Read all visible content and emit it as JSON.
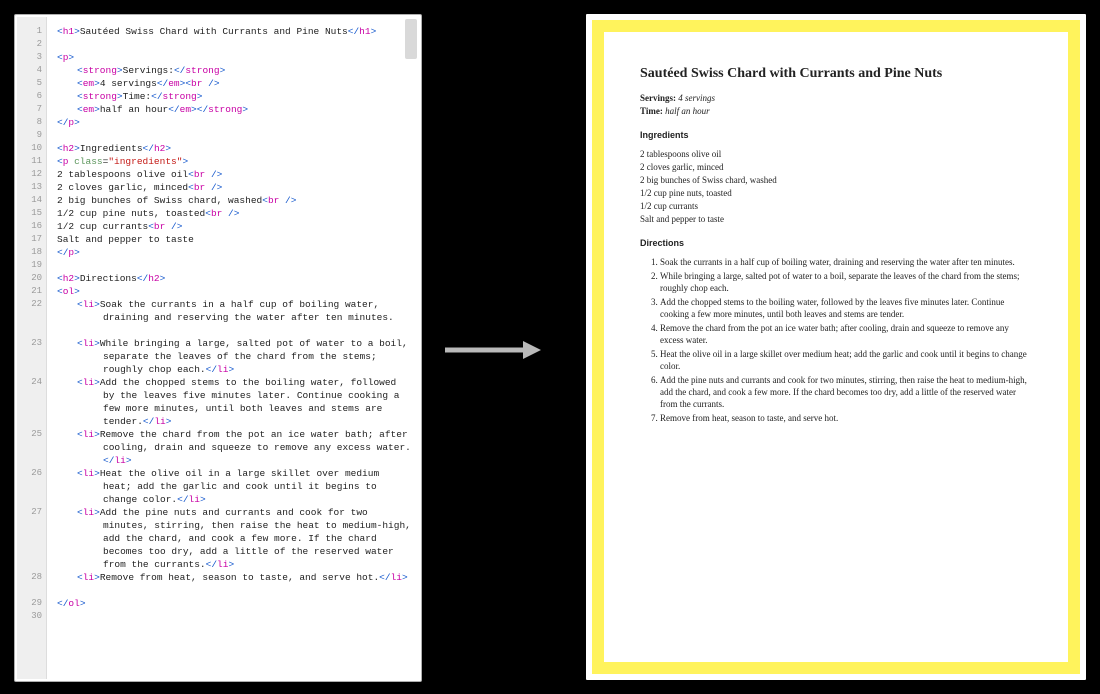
{
  "editor": {
    "total_lines": 30,
    "lines": [
      {
        "n": 1,
        "h": 1,
        "html": "<span class='tag'>&lt;</span><span class='kw'>h1</span><span class='tag'>&gt;</span>Sautéed Swiss Chard with Currants and Pine Nuts<span class='tag'>&lt;/</span><span class='kw'>h1</span><span class='tag'>&gt;</span>"
      },
      {
        "n": 2,
        "h": 1,
        "html": ""
      },
      {
        "n": 3,
        "h": 1,
        "html": "<span class='tag'>&lt;</span><span class='kw'>p</span><span class='tag'>&gt;</span>"
      },
      {
        "n": 4,
        "h": 1,
        "indent": 1,
        "html": "<span class='tag'>&lt;</span><span class='kw'>strong</span><span class='tag'>&gt;</span>Servings:<span class='tag'>&lt;/</span><span class='kw'>strong</span><span class='tag'>&gt;</span>"
      },
      {
        "n": 5,
        "h": 1,
        "indent": 1,
        "html": "<span class='tag'>&lt;</span><span class='kw'>em</span><span class='tag'>&gt;</span>4 servings<span class='tag'>&lt;/</span><span class='kw'>em</span><span class='tag'>&gt;&lt;</span><span class='kw'>br</span> <span class='tag'>/&gt;</span>"
      },
      {
        "n": 6,
        "h": 1,
        "indent": 1,
        "html": "<span class='tag'>&lt;</span><span class='kw'>strong</span><span class='tag'>&gt;</span>Time:<span class='tag'>&lt;/</span><span class='kw'>strong</span><span class='tag'>&gt;</span>"
      },
      {
        "n": 7,
        "h": 1,
        "indent": 1,
        "html": "<span class='tag'>&lt;</span><span class='kw'>em</span><span class='tag'>&gt;</span>half an hour<span class='tag'>&lt;/</span><span class='kw'>em</span><span class='tag'>&gt;&lt;/</span><span class='kw'>strong</span><span class='tag'>&gt;</span>"
      },
      {
        "n": 8,
        "h": 1,
        "html": "<span class='tag'>&lt;/</span><span class='kw'>p</span><span class='tag'>&gt;</span>"
      },
      {
        "n": 9,
        "h": 1,
        "html": ""
      },
      {
        "n": 10,
        "h": 1,
        "html": "<span class='tag'>&lt;</span><span class='kw'>h2</span><span class='tag'>&gt;</span>Ingredients<span class='tag'>&lt;/</span><span class='kw'>h2</span><span class='tag'>&gt;</span>"
      },
      {
        "n": 11,
        "h": 1,
        "html": "<span class='tag'>&lt;</span><span class='kw'>p</span> <span class='attr'>class</span>=<span class='str'>\"ingredients\"</span><span class='tag'>&gt;</span>"
      },
      {
        "n": 12,
        "h": 1,
        "html": "2 tablespoons olive oil<span class='tag'>&lt;</span><span class='kw'>br</span> <span class='tag'>/&gt;</span>"
      },
      {
        "n": 13,
        "h": 1,
        "html": "2 cloves garlic, minced<span class='tag'>&lt;</span><span class='kw'>br</span> <span class='tag'>/&gt;</span>"
      },
      {
        "n": 14,
        "h": 1,
        "html": "2 big bunches of Swiss chard, washed<span class='tag'>&lt;</span><span class='kw'>br</span> <span class='tag'>/&gt;</span>"
      },
      {
        "n": 15,
        "h": 1,
        "html": "1/2 cup pine nuts, toasted<span class='tag'>&lt;</span><span class='kw'>br</span> <span class='tag'>/&gt;</span>"
      },
      {
        "n": 16,
        "h": 1,
        "html": "1/2 cup currants<span class='tag'>&lt;</span><span class='kw'>br</span> <span class='tag'>/&gt;</span>"
      },
      {
        "n": 17,
        "h": 1,
        "html": "Salt and pepper to taste"
      },
      {
        "n": 18,
        "h": 1,
        "html": "<span class='tag'>&lt;/</span><span class='kw'>p</span><span class='tag'>&gt;</span>"
      },
      {
        "n": 19,
        "h": 1,
        "html": ""
      },
      {
        "n": 20,
        "h": 1,
        "html": "<span class='tag'>&lt;</span><span class='kw'>h2</span><span class='tag'>&gt;</span>Directions<span class='tag'>&lt;/</span><span class='kw'>h2</span><span class='tag'>&gt;</span>"
      },
      {
        "n": 21,
        "h": 1,
        "html": "<span class='tag'>&lt;</span><span class='kw'>ol</span><span class='tag'>&gt;</span>"
      },
      {
        "n": 22,
        "h": 3,
        "hang": true,
        "html": "<span class='tag'>&lt;</span><span class='kw'>li</span><span class='tag'>&gt;</span>Soak the currants in a half cup of boiling water, draining and reserving the water after ten minutes."
      },
      {
        "n": 23,
        "h": 3,
        "hang": true,
        "html": "<span class='tag'>&lt;</span><span class='kw'>li</span><span class='tag'>&gt;</span>While bringing a large, salted pot of water to a boil, separate the leaves of the chard from the stems; roughly chop each.<span class='tag'>&lt;/</span><span class='kw'>li</span><span class='tag'>&gt;</span>"
      },
      {
        "n": 24,
        "h": 4,
        "hang": true,
        "html": "<span class='tag'>&lt;</span><span class='kw'>li</span><span class='tag'>&gt;</span>Add the chopped stems to the boiling water, followed by the leaves five minutes later. Continue cooking a few more minutes, until both leaves and stems are tender.<span class='tag'>&lt;/</span><span class='kw'>li</span><span class='tag'>&gt;</span>"
      },
      {
        "n": 25,
        "h": 3,
        "hang": true,
        "html": "<span class='tag'>&lt;</span><span class='kw'>li</span><span class='tag'>&gt;</span>Remove the chard from the pot an ice water bath; after cooling, drain and squeeze to remove any excess water.<span class='tag'>&lt;/</span><span class='kw'>li</span><span class='tag'>&gt;</span>"
      },
      {
        "n": 26,
        "h": 3,
        "hang": true,
        "html": "<span class='tag'>&lt;</span><span class='kw'>li</span><span class='tag'>&gt;</span>Heat the olive oil in a large skillet over medium heat; add the garlic and cook until it begins to change color.<span class='tag'>&lt;/</span><span class='kw'>li</span><span class='tag'>&gt;</span>"
      },
      {
        "n": 27,
        "h": 5,
        "hang": true,
        "html": "<span class='tag'>&lt;</span><span class='kw'>li</span><span class='tag'>&gt;</span>Add the pine nuts and currants and cook for two minutes, stirring, then raise the heat to medium-high, add the chard, and cook a few more. If the chard becomes too dry, add a little of the reserved water from the currants.<span class='tag'>&lt;/</span><span class='kw'>li</span><span class='tag'>&gt;</span>"
      },
      {
        "n": 28,
        "h": 2,
        "hang": true,
        "html": "<span class='tag'>&lt;</span><span class='kw'>li</span><span class='tag'>&gt;</span>Remove from heat, season to taste, and serve hot.<span class='tag'>&lt;/</span><span class='kw'>li</span><span class='tag'>&gt;</span>"
      },
      {
        "n": 29,
        "h": 1,
        "html": "<span class='tag'>&lt;/</span><span class='kw'>ol</span><span class='tag'>&gt;</span>"
      },
      {
        "n": 30,
        "h": 1,
        "html": ""
      }
    ]
  },
  "recipe": {
    "title": "Sautéed Swiss Chard with Currants and Pine Nuts",
    "servings_label": "Servings:",
    "servings_value": "4 servings",
    "time_label": "Time:",
    "time_value": "half an hour",
    "ingredients_heading": "Ingredients",
    "ingredients": [
      "2 tablespoons olive oil",
      "2 cloves garlic, minced",
      "2 big bunches of Swiss chard, washed",
      "1/2 cup pine nuts, toasted",
      "1/2 cup currants",
      "Salt and pepper to taste"
    ],
    "directions_heading": "Directions",
    "directions": [
      "Soak the currants in a half cup of boiling water, draining and reserving the water after ten minutes.",
      "While bringing a large, salted pot of water to a boil, separate the leaves of the chard from the stems; roughly chop each.",
      "Add the chopped stems to the boiling water, followed by the leaves five minutes later. Continue cooking a few more minutes, until both leaves and stems are tender.",
      "Remove the chard from the pot an ice water bath; after cooling, drain and squeeze to remove any excess water.",
      "Heat the olive oil in a large skillet over medium heat; add the garlic and cook until it begins to change color.",
      "Add the pine nuts and currants and cook for two minutes, stirring, then raise the heat to medium-high, add the chard, and cook a few more. If the chard becomes too dry, add a little of the reserved water from the currants.",
      "Remove from heat, season to taste, and serve hot."
    ]
  }
}
